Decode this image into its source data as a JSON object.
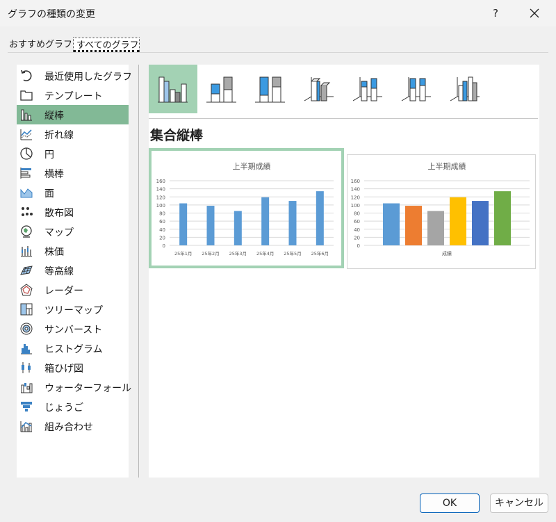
{
  "window": {
    "title": "グラフの種類の変更",
    "help": "?"
  },
  "tabs": [
    {
      "label": "おすすめグラフ"
    },
    {
      "label": "すべてのグラフ",
      "selected": true
    }
  ],
  "sidebar": {
    "items": [
      {
        "label": "最近使用したグラフ",
        "icon": "recent-icon"
      },
      {
        "label": "テンプレート",
        "icon": "folder-icon"
      },
      {
        "label": "縦棒",
        "icon": "column-chart-icon",
        "selected": true
      },
      {
        "label": "折れ線",
        "icon": "line-chart-icon"
      },
      {
        "label": "円",
        "icon": "pie-chart-icon"
      },
      {
        "label": "横棒",
        "icon": "bar-chart-icon"
      },
      {
        "label": "面",
        "icon": "area-chart-icon"
      },
      {
        "label": "散布図",
        "icon": "scatter-chart-icon"
      },
      {
        "label": "マップ",
        "icon": "map-chart-icon"
      },
      {
        "label": "株価",
        "icon": "stock-chart-icon"
      },
      {
        "label": "等高線",
        "icon": "surface-chart-icon"
      },
      {
        "label": "レーダー",
        "icon": "radar-chart-icon"
      },
      {
        "label": "ツリーマップ",
        "icon": "treemap-icon"
      },
      {
        "label": "サンバースト",
        "icon": "sunburst-icon"
      },
      {
        "label": "ヒストグラム",
        "icon": "histogram-icon"
      },
      {
        "label": "箱ひげ図",
        "icon": "box-whisker-icon"
      },
      {
        "label": "ウォーターフォール",
        "icon": "waterfall-icon"
      },
      {
        "label": "じょうご",
        "icon": "funnel-icon"
      },
      {
        "label": "組み合わせ",
        "icon": "combo-chart-icon"
      }
    ]
  },
  "subtypes": [
    {
      "icon": "clustered-column-icon",
      "selected": true
    },
    {
      "icon": "stacked-column-icon"
    },
    {
      "icon": "100-stacked-column-icon"
    },
    {
      "icon": "3d-clustered-column-icon"
    },
    {
      "icon": "3d-stacked-column-icon"
    },
    {
      "icon": "3d-100-stacked-column-icon"
    },
    {
      "icon": "3d-column-icon"
    }
  ],
  "section_title": "集合縦棒",
  "colors": {
    "accent_green": "#82b996",
    "selection_green": "#a3d2b4",
    "bar_blue": "#5b9bd5",
    "ok_border": "#005fb8"
  },
  "chart_data": [
    {
      "type": "bar",
      "title": "上半期成績",
      "categories": [
        "25年1月",
        "25年2月",
        "25年3月",
        "25年4月",
        "25年5月",
        "25年6月"
      ],
      "values": [
        104,
        98,
        85,
        119,
        110,
        134
      ],
      "ylim": [
        0,
        160
      ],
      "yticks": [
        0,
        20,
        40,
        60,
        80,
        100,
        120,
        140,
        160
      ],
      "grid": true,
      "colors": [
        "#5b9bd5",
        "#5b9bd5",
        "#5b9bd5",
        "#5b9bd5",
        "#5b9bd5",
        "#5b9bd5"
      ]
    },
    {
      "type": "bar",
      "title": "上半期成績",
      "categories": [
        "成績"
      ],
      "series": [
        {
          "values": [
            104
          ],
          "color": "#5b9bd5"
        },
        {
          "values": [
            98
          ],
          "color": "#ed7d31"
        },
        {
          "values": [
            85
          ],
          "color": "#a5a5a5"
        },
        {
          "values": [
            119
          ],
          "color": "#ffc000"
        },
        {
          "values": [
            110
          ],
          "color": "#4472c4"
        },
        {
          "values": [
            134
          ],
          "color": "#70ad47"
        }
      ],
      "ylim": [
        0,
        160
      ],
      "yticks": [
        0,
        20,
        40,
        60,
        80,
        100,
        120,
        140,
        160
      ],
      "grid": true
    }
  ],
  "footer": {
    "ok_label": "OK",
    "cancel_label": "キャンセル"
  }
}
